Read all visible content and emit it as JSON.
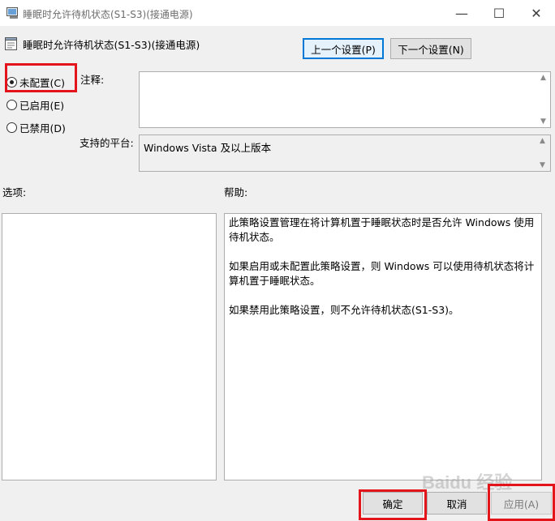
{
  "window": {
    "title": "睡眠时允许待机状态(S1-S3)(接通电源)",
    "min_glyph": "—",
    "max_glyph": "☐",
    "close_glyph": "✕"
  },
  "header": {
    "policy_title": "睡眠时允许待机状态(S1-S3)(接通电源)",
    "prev_label": "上一个设置(P)",
    "next_label": "下一个设置(N)"
  },
  "state": {
    "options": [
      {
        "label": "未配置(C)",
        "selected": true
      },
      {
        "label": "已启用(E)",
        "selected": false
      },
      {
        "label": "已禁用(D)",
        "selected": false
      }
    ]
  },
  "comment": {
    "label": "注释:",
    "value": ""
  },
  "platform": {
    "label": "支持的平台:",
    "value": "Windows Vista 及以上版本"
  },
  "options_section": {
    "label": "选项:"
  },
  "help_section": {
    "label": "帮助:",
    "paragraphs": [
      "此策略设置管理在将计算机置于睡眠状态时是否允许 Windows 使用待机状态。",
      "如果启用或未配置此策略设置，则 Windows 可以使用待机状态将计算机置于睡眠状态。",
      "如果禁用此策略设置，则不允许待机状态(S1-S3)。"
    ]
  },
  "footer": {
    "ok_label": "确定",
    "cancel_label": "取消",
    "apply_label": "应用(A)"
  },
  "watermark": {
    "text": "Baidu 经验"
  },
  "colors": {
    "highlight_red": "#e3141a",
    "focus_blue": "#0078d7"
  }
}
